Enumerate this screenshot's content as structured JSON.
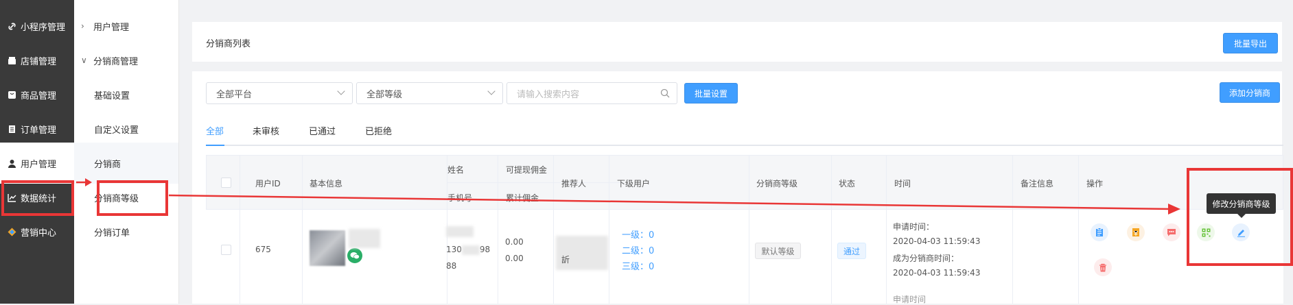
{
  "sidebar": {
    "items": [
      {
        "label": "小程序管理",
        "icon": "link-icon"
      },
      {
        "label": "店铺管理",
        "icon": "store-icon"
      },
      {
        "label": "商品管理",
        "icon": "goods-icon"
      },
      {
        "label": "订单管理",
        "icon": "order-icon"
      },
      {
        "label": "用户管理",
        "icon": "user-icon"
      },
      {
        "label": "数据统计",
        "icon": "chart-icon"
      },
      {
        "label": "营销中心",
        "icon": "marketing-icon"
      }
    ]
  },
  "submenu": {
    "items": [
      {
        "label": "用户管理"
      },
      {
        "label": "分销商管理"
      },
      {
        "label": "基础设置"
      },
      {
        "label": "自定义设置"
      },
      {
        "label": "分销商"
      },
      {
        "label": "分销商等级"
      },
      {
        "label": "分销订单"
      }
    ]
  },
  "header": {
    "title": "分销商列表",
    "export_label": "批量导出"
  },
  "filters": {
    "platform": "全部平台",
    "level": "全部等级",
    "search_placeholder": "请输入搜索内容",
    "batch_label": "批量设置",
    "add_label": "添加分销商"
  },
  "tabs": [
    {
      "label": "全部"
    },
    {
      "label": "未审核"
    },
    {
      "label": "已通过"
    },
    {
      "label": "已拒绝"
    }
  ],
  "table": {
    "headers": {
      "user_id": "用户ID",
      "basic_info": "基本信息",
      "name": "姓名",
      "phone": "手机号",
      "withdrawable": "可提现佣金",
      "total": "累计佣金",
      "referrer": "推荐人",
      "sub_users": "下级用户",
      "level": "分销商等级",
      "status": "状态",
      "time": "时间",
      "remark": "备注信息",
      "ops": "操作"
    },
    "rows": [
      {
        "user_id": "675",
        "phone_a": "130",
        "phone_b": "98",
        "phone_c": "88",
        "withdrawable": "0.00",
        "total": "0.00",
        "referrer_char": "訢",
        "sub1": "一级：0",
        "sub2": "二级：0",
        "sub3": "三级：0",
        "level": "默认等级",
        "status": "通过",
        "apply_label": "申请时间：",
        "apply_time": "2020-04-03 11:59:43",
        "become_label": "成为分销商时间：",
        "become_time": "2020-04-03 11:59:43"
      }
    ],
    "row2_time_label": "申请时间"
  },
  "tooltip": "修改分销商等级",
  "colors": {
    "primary": "#409eff",
    "sidebar": "#3a3a3a",
    "annotation": "#e93636"
  }
}
